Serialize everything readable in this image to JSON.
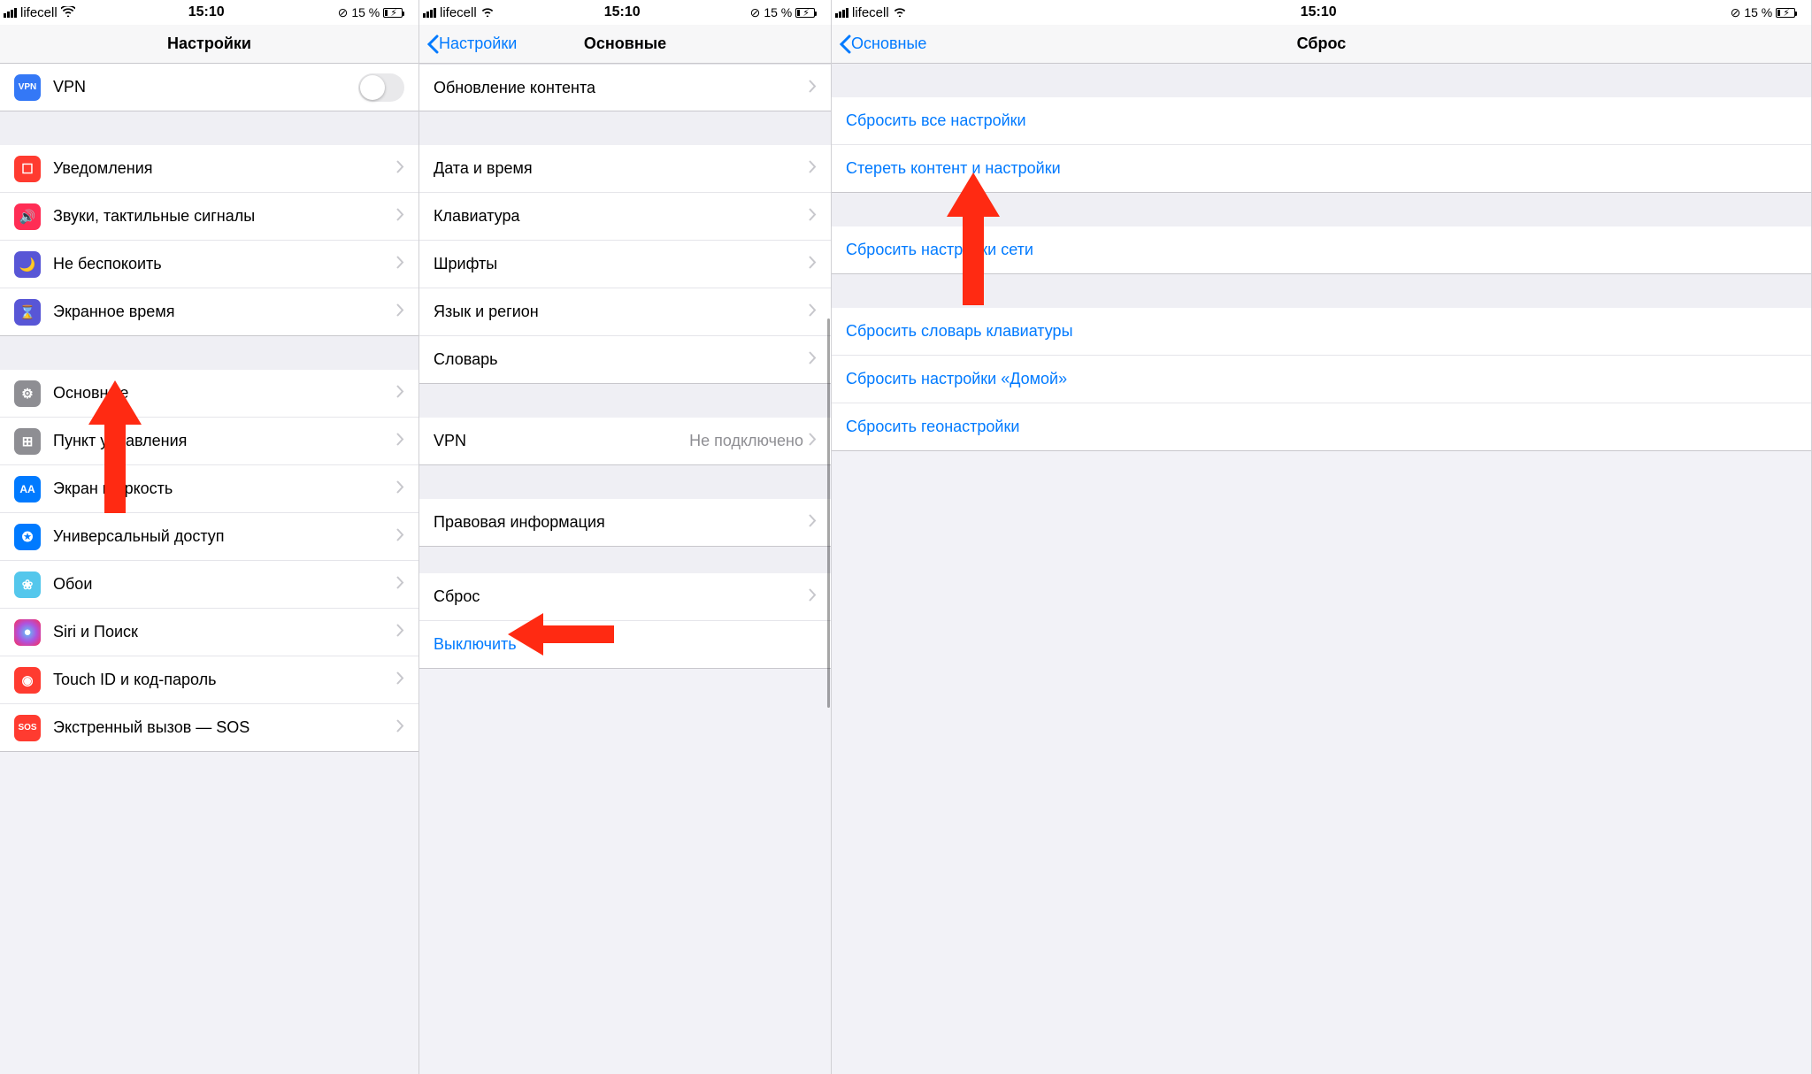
{
  "status": {
    "carrier": "lifecell",
    "time": "15:10",
    "battery": "15 %"
  },
  "panes": [
    {
      "title": "Настройки",
      "back": null,
      "sections": [
        {
          "rows": [
            {
              "icon": "vpn",
              "label": "VPN",
              "toggle": true
            }
          ]
        },
        {
          "gap": true,
          "rows": [
            {
              "icon": "notif",
              "label": "Уведомления",
              "chev": true
            },
            {
              "icon": "sound",
              "label": "Звуки, тактильные сигналы",
              "chev": true
            },
            {
              "icon": "dnd",
              "label": "Не беспокоить",
              "chev": true
            },
            {
              "icon": "screentime",
              "label": "Экранное время",
              "chev": true
            }
          ]
        },
        {
          "gap": true,
          "rows": [
            {
              "icon": "general",
              "label": "Основные",
              "chev": true
            },
            {
              "icon": "control",
              "label": "Пункт управления",
              "chev": true
            },
            {
              "icon": "display",
              "label": "Экран и яркость",
              "chev": true
            },
            {
              "icon": "access",
              "label": "Универсальный доступ",
              "chev": true
            },
            {
              "icon": "wall",
              "label": "Обои",
              "chev": true
            },
            {
              "icon": "siri",
              "label": "Siri и Поиск",
              "chev": true
            },
            {
              "icon": "touchid",
              "label": "Touch ID и код-пароль",
              "chev": true
            },
            {
              "icon": "sos",
              "label": "Экстренный вызов — SOS",
              "chev": true
            }
          ]
        }
      ]
    },
    {
      "title": "Основные",
      "back": "Настройки",
      "sections": [
        {
          "rows": [
            {
              "label": "Обновление контента",
              "chev": true
            }
          ]
        },
        {
          "gap": true,
          "rows": [
            {
              "label": "Дата и время",
              "chev": true
            },
            {
              "label": "Клавиатура",
              "chev": true
            },
            {
              "label": "Шрифты",
              "chev": true
            },
            {
              "label": "Язык и регион",
              "chev": true
            },
            {
              "label": "Словарь",
              "chev": true
            }
          ]
        },
        {
          "gap": true,
          "rows": [
            {
              "label": "VPN",
              "detail": "Не подключено",
              "chev": true
            }
          ]
        },
        {
          "gap": true,
          "rows": [
            {
              "label": "Правовая информация",
              "chev": true
            }
          ]
        },
        {
          "gap": true,
          "rows": [
            {
              "label": "Сброс",
              "chev": true
            },
            {
              "label": "Выключить",
              "blue": true
            }
          ]
        }
      ]
    },
    {
      "title": "Сброс",
      "back": "Основные",
      "sections": [
        {
          "gap": true,
          "rows": [
            {
              "label": "Сбросить все настройки",
              "blue": true
            },
            {
              "label": "Стереть контент и настройки",
              "blue": true
            }
          ]
        },
        {
          "gap": true,
          "rows": [
            {
              "label": "Сбросить настройки сети",
              "blue": true
            }
          ]
        },
        {
          "gap": true,
          "rows": [
            {
              "label": "Сбросить словарь клавиатуры",
              "blue": true
            },
            {
              "label": "Сбросить настройки «Домой»",
              "blue": true
            },
            {
              "label": "Сбросить геонастройки",
              "blue": true
            }
          ]
        }
      ]
    }
  ]
}
